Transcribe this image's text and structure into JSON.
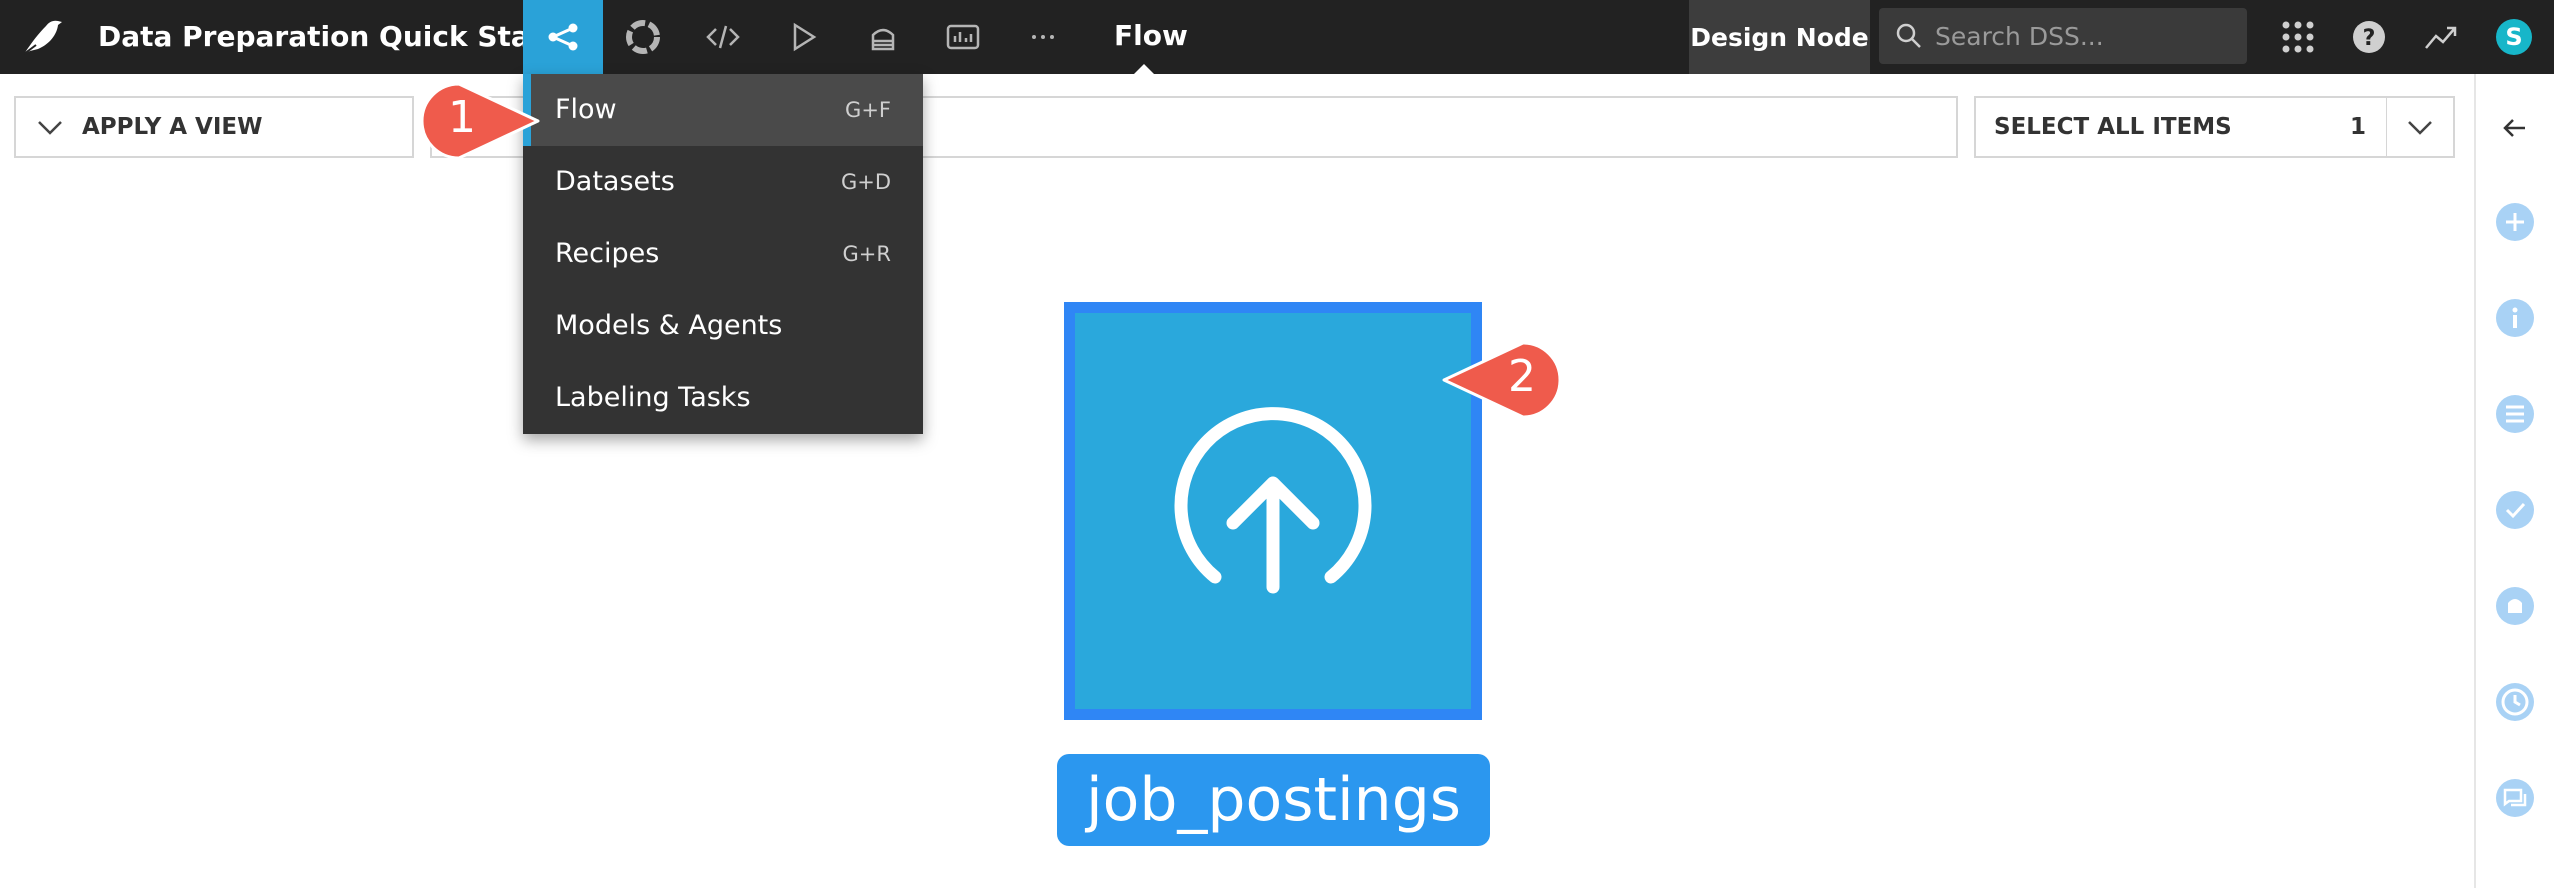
{
  "topbar": {
    "project_title": "Data Preparation Quick Start",
    "current_section": "Flow",
    "node_label": "Design Node",
    "search_placeholder": "Search DSS...",
    "avatar_initial": "S",
    "accent_color": "#2aa2d8"
  },
  "nav_icons": [
    "flow-icon",
    "lifecycle-icon",
    "code-icon",
    "run-icon",
    "dashboard-stack-icon",
    "insights-icon",
    "more-icon"
  ],
  "toolbar": {
    "apply_view_label": "APPLY A VIEW",
    "select_all_label": "SELECT ALL ITEMS",
    "select_all_count": "1"
  },
  "menu": {
    "items": [
      {
        "label": "Flow",
        "shortcut": "G+F",
        "active": true
      },
      {
        "label": "Datasets",
        "shortcut": "G+D"
      },
      {
        "label": "Recipes",
        "shortcut": "G+R"
      },
      {
        "label": "Models & Agents",
        "shortcut": ""
      },
      {
        "label": "Labeling Tasks",
        "shortcut": ""
      }
    ]
  },
  "flow": {
    "dataset_name": "job_postings",
    "dataset_color": "#2aa8dc",
    "selection_color": "#2f86f5"
  },
  "callouts": [
    {
      "number": "1"
    },
    {
      "number": "2"
    }
  ],
  "right_panel_icons": [
    "collapse-arrow-icon",
    "add-icon",
    "info-icon",
    "schema-icon",
    "check-icon",
    "lab-icon",
    "history-icon",
    "discussions-icon"
  ],
  "colors": {
    "callout": "#ef5b4c",
    "panel_icon": "#a9d2f5"
  }
}
